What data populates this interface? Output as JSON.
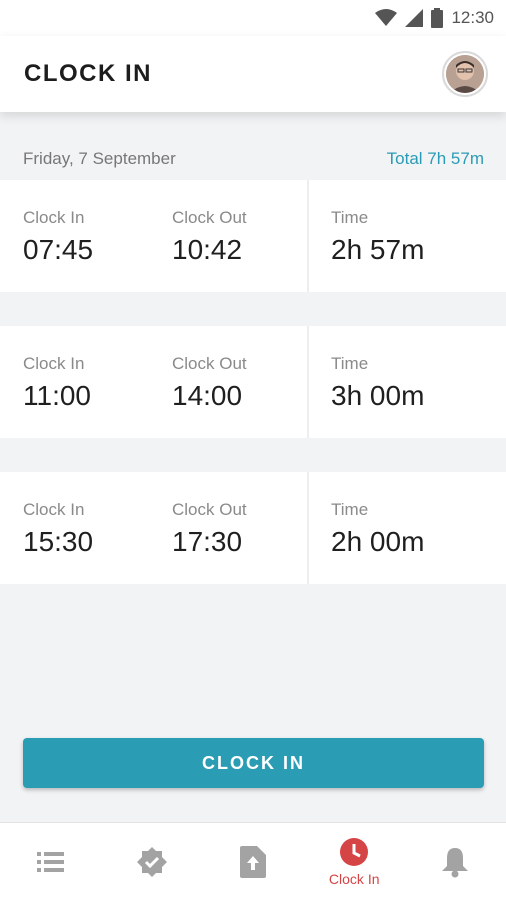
{
  "status_bar": {
    "time": "12:30"
  },
  "app_bar": {
    "title": "CLOCK IN"
  },
  "day": {
    "date": "Friday, 7 September",
    "total": "Total 7h 57m"
  },
  "entries": [
    {
      "in_label": "Clock In",
      "in_value": "07:45",
      "out_label": "Clock Out",
      "out_value": "10:42",
      "time_label": "Time",
      "time_value": "2h 57m"
    },
    {
      "in_label": "Clock In",
      "in_value": "11:00",
      "out_label": "Clock Out",
      "out_value": "14:00",
      "time_label": "Time",
      "time_value": "3h 00m"
    },
    {
      "in_label": "Clock In",
      "in_value": "15:30",
      "out_label": "Clock Out",
      "out_value": "17:30",
      "time_label": "Time",
      "time_value": "2h 00m"
    }
  ],
  "clock_in_button": {
    "label": "CLOCK IN"
  },
  "bottom_nav": {
    "items": [
      {
        "icon": "list-icon",
        "label": ""
      },
      {
        "icon": "verified-badge-icon",
        "label": ""
      },
      {
        "icon": "upload-file-icon",
        "label": ""
      },
      {
        "icon": "clock-icon",
        "label": "Clock In",
        "active": true
      },
      {
        "icon": "bell-icon",
        "label": ""
      }
    ]
  },
  "colors": {
    "accent": "#2a9db4",
    "active_nav": "#d64545",
    "background": "#f2f3f5"
  }
}
